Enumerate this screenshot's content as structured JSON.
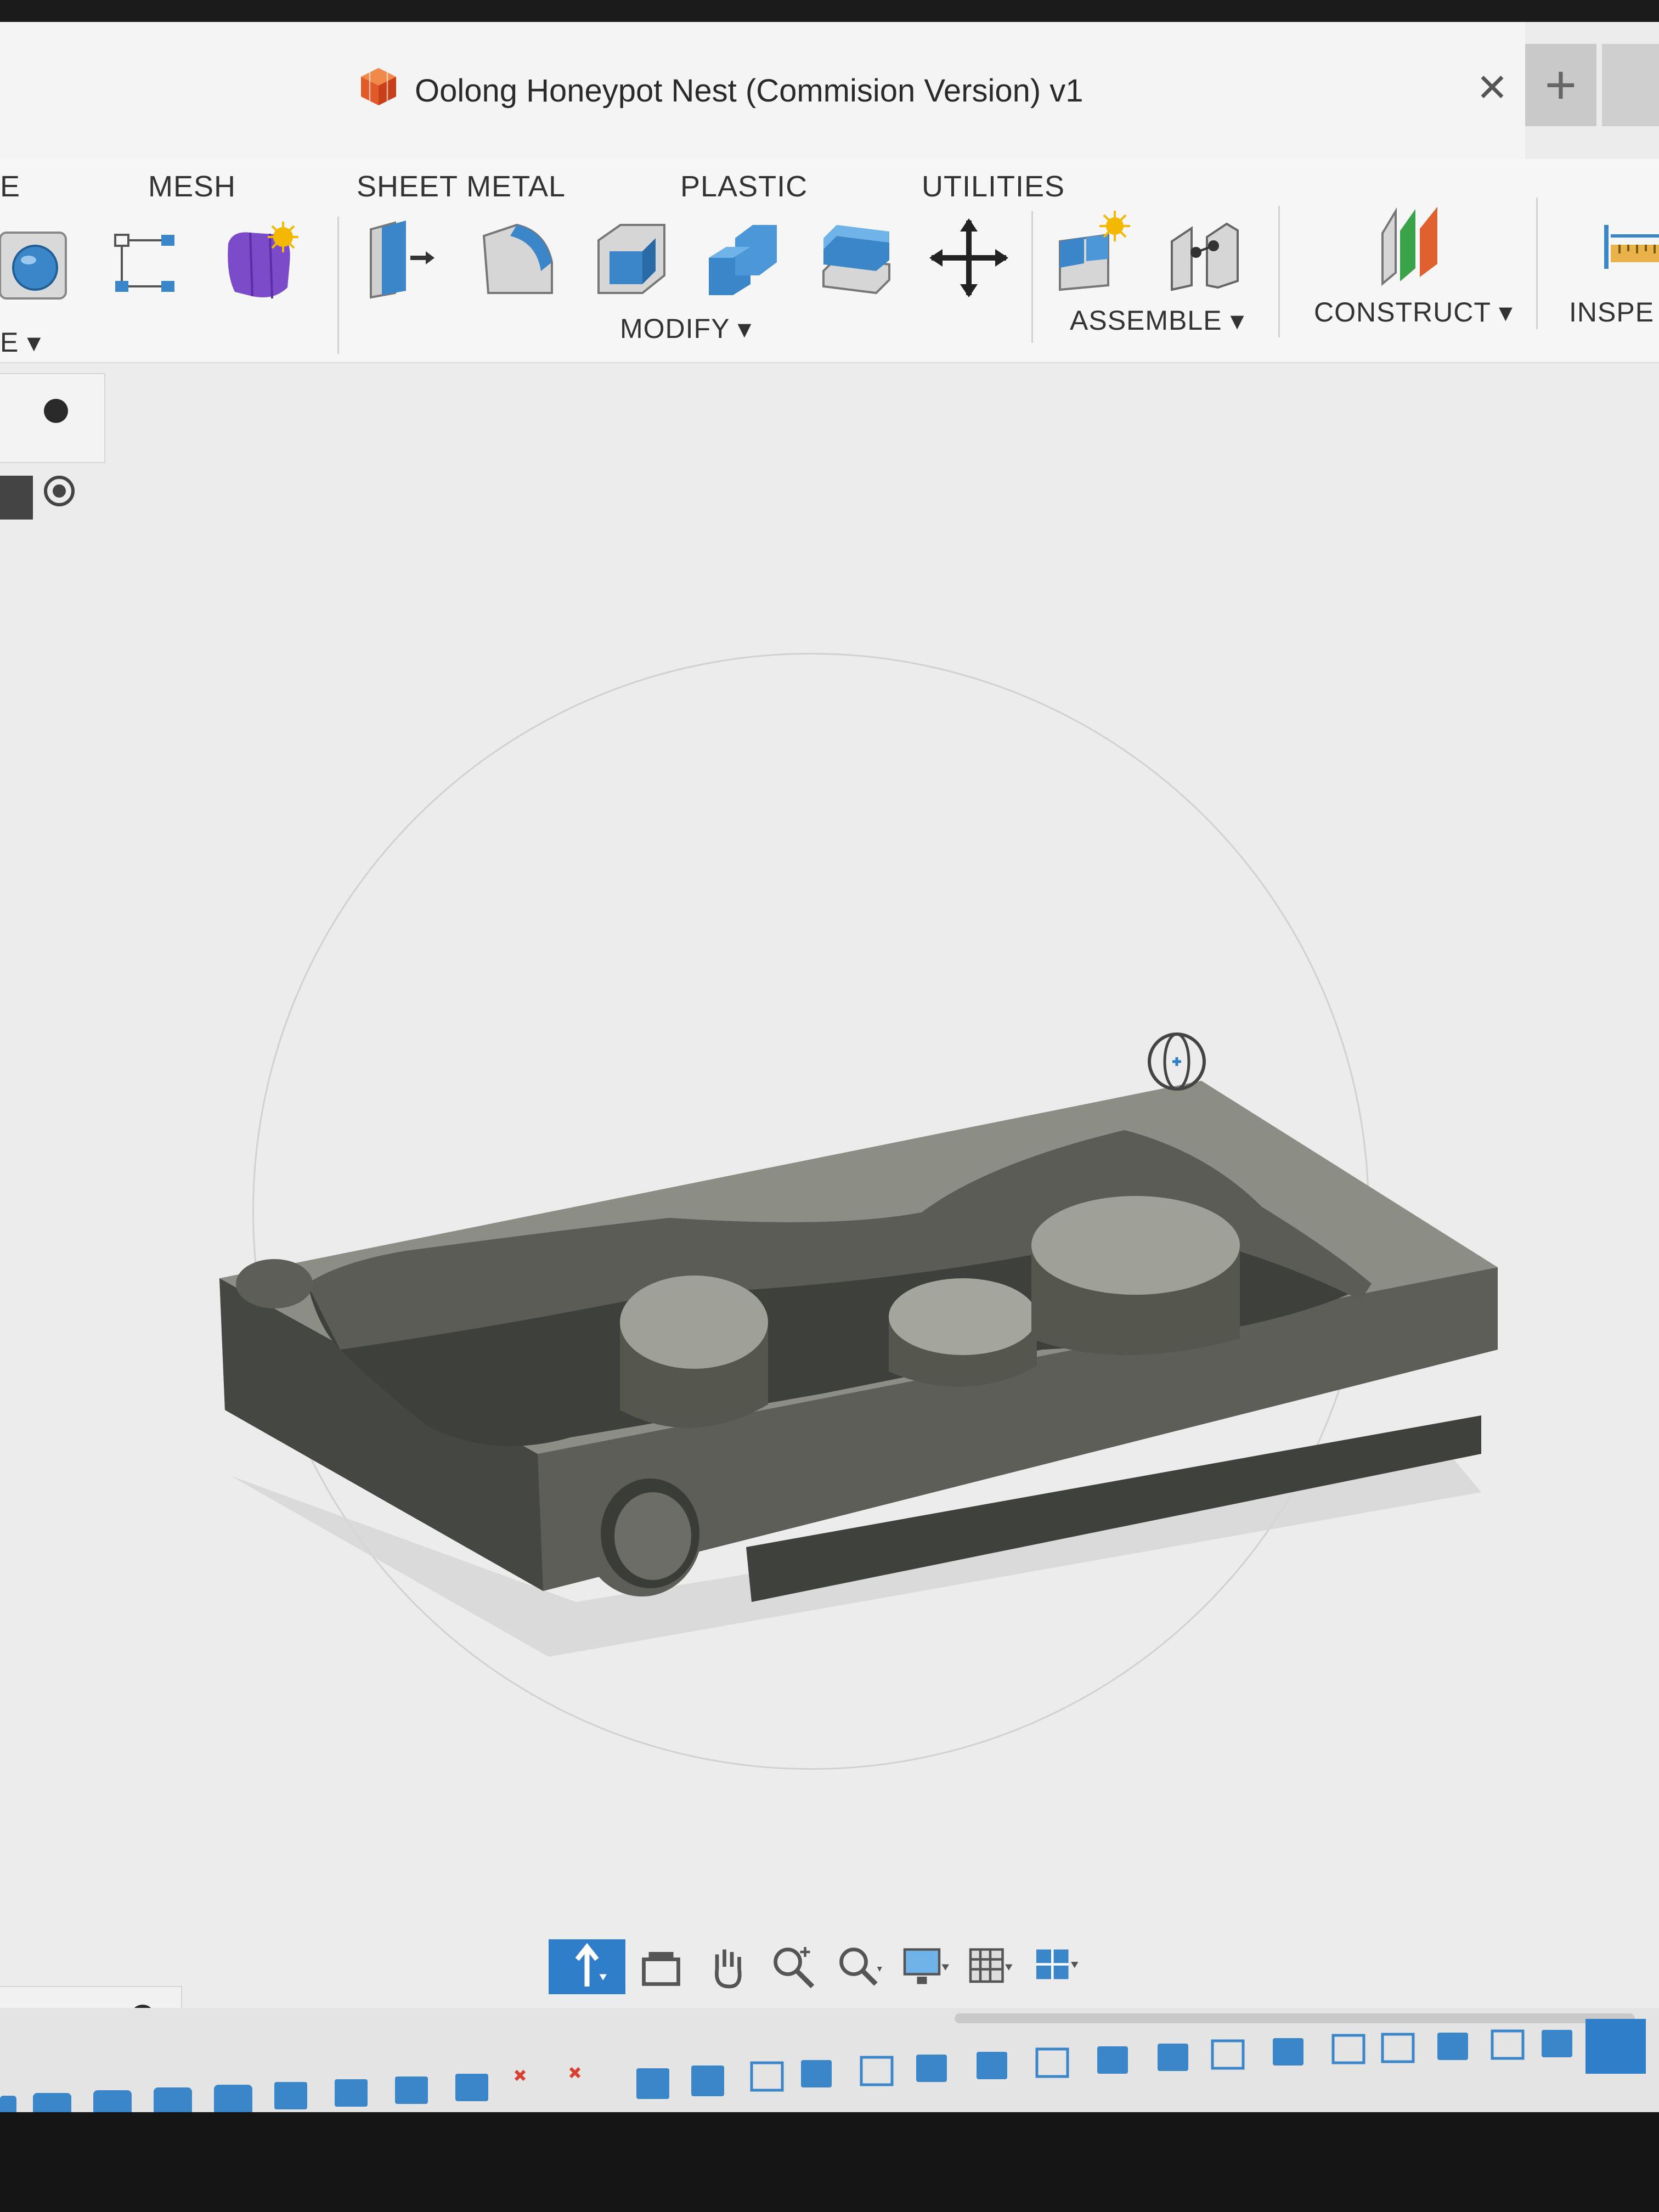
{
  "window": {
    "title": "Oolong Honeypot Nest (Commision Version) v1",
    "close_label": "✕",
    "new_tab_label": "+"
  },
  "workspace_tabs": [
    "E",
    "MESH",
    "SHEET METAL",
    "PLASTIC",
    "UTILITIES"
  ],
  "groups": {
    "create": "E ▾",
    "modify": "MODIFY ▾",
    "assemble": "ASSEMBLE ▾",
    "construct": "CONSTRUCT ▾",
    "inspect": "INSPE"
  },
  "icons": {
    "document": "cube-document-icon",
    "tools": [
      "sphere-icon",
      "sketch-icon",
      "form-icon",
      "press-pull-icon",
      "fillet-icon",
      "shell-icon",
      "combine-icon",
      "stack-icon",
      "move-icon",
      "new-component-icon",
      "joint-icon",
      "plane-icon",
      "measure-icon"
    ],
    "nav": [
      "orbit-icon",
      "look-at-icon",
      "pan-icon",
      "zoom-icon",
      "fit-icon",
      "display-icon",
      "grid-icon",
      "viewports-icon"
    ]
  },
  "colors": {
    "accent": "#2f7ec9",
    "body": "#6b6d66",
    "body_dark": "#4f514b",
    "body_light": "#8b8d86",
    "top_face": "#9fa198"
  }
}
